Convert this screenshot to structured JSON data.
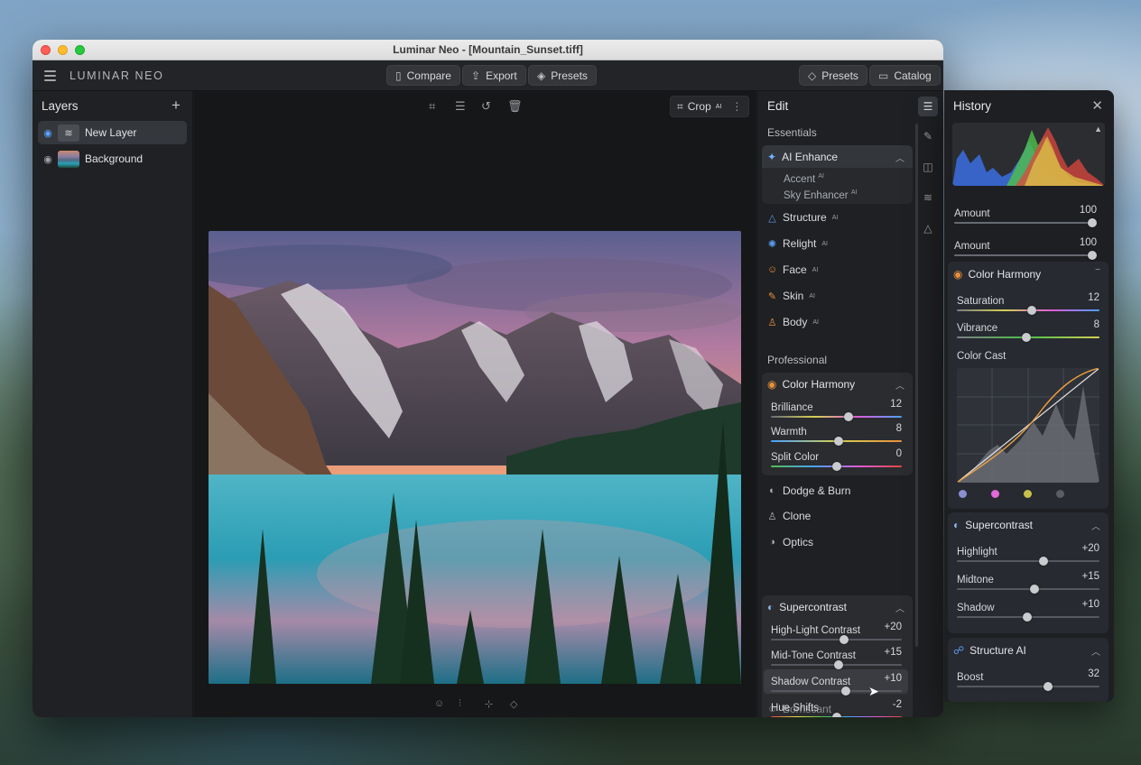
{
  "window": {
    "title": "Luminar Neo - [Mountain_Sunset.tiff]"
  },
  "toolbar": {
    "brand": "LUMINAR NEO",
    "compare": "Compare",
    "export": "Export",
    "presets_center": "Presets",
    "presets_right": "Presets",
    "catalog": "Catalog"
  },
  "layers": {
    "title": "Layers",
    "items": [
      {
        "label": "New Layer",
        "selected": true
      },
      {
        "label": "Background",
        "selected": false
      }
    ]
  },
  "canvas": {
    "crop_label": "Crop",
    "crop_ai": "AI"
  },
  "edit": {
    "title": "Edit",
    "essentials_label": "Essentials",
    "ai_enhance": {
      "label": "AI Enhance",
      "accent": "Accent",
      "sky": "Sky Enhancer",
      "ai": "AI"
    },
    "essentials_tools": [
      {
        "label": "Structure",
        "icon": "triangle-icon",
        "color": "#5a9cf0"
      },
      {
        "label": "Relight",
        "icon": "sun-icon",
        "color": "#5a9cf0"
      },
      {
        "label": "Face",
        "icon": "face-icon",
        "color": "#e8903a"
      },
      {
        "label": "Skin",
        "icon": "brush-icon",
        "color": "#e8903a"
      },
      {
        "label": "Body",
        "icon": "body-icon",
        "color": "#e8903a"
      }
    ],
    "professional_label": "Professional",
    "color_harmony": {
      "label": "Color Harmony",
      "sliders": [
        {
          "label": "Brilliance",
          "value": "12",
          "pos": 0.59
        },
        {
          "label": "Warmth",
          "value": "8",
          "pos": 0.52
        },
        {
          "label": "Split Color",
          "value": "0",
          "pos": 0.5
        }
      ]
    },
    "pro_tools": [
      {
        "label": "Dodge & Burn",
        "icon": "dodge-icon"
      },
      {
        "label": "Clone",
        "icon": "clone-icon"
      },
      {
        "label": "Optics",
        "icon": "optics-icon"
      }
    ],
    "supercontrast": {
      "label": "Supercontrast",
      "sliders": [
        {
          "label": "High-Light Contrast",
          "value": "+20",
          "pos": 0.56
        },
        {
          "label": "Mid-Tone Contrast",
          "value": "+15",
          "pos": 0.52
        },
        {
          "label": "Shadow Contrast",
          "value": "+10",
          "pos": 0.57
        },
        {
          "label": "Hue Shifts",
          "value": "-2",
          "pos": 0.5
        }
      ]
    },
    "cut_off_item": "Borriscant"
  },
  "history": {
    "title": "History",
    "amount1": {
      "label": "Amount",
      "value": "100",
      "pos": 1.0
    },
    "amount2": {
      "label": "Amount",
      "value": "100",
      "pos": 1.0
    },
    "color_harmony": {
      "label": "Color Harmony",
      "saturation": {
        "label": "Saturation",
        "value": "12",
        "pos": 0.54
      },
      "vibrance": {
        "label": "Vibrance",
        "value": "8",
        "pos": 0.5
      },
      "color_cast": "Color Cast"
    },
    "supercontrast": {
      "label": "Supercontrast",
      "highlight": {
        "label": "Highlight",
        "value": "+20",
        "pos": 0.63
      },
      "midtone": {
        "label": "Midtone",
        "value": "+15",
        "pos": 0.56
      },
      "shadow": {
        "label": "Shadow",
        "value": "+10",
        "pos": 0.51
      }
    },
    "structure_ai": {
      "label": "Structure AI",
      "boost": {
        "label": "Boost",
        "value": "32",
        "pos": 0.66
      }
    }
  },
  "colors": {
    "accent": "#5a9cf0",
    "ai_enhance": "#6fb0ff",
    "warn_orange": "#e8903a"
  }
}
